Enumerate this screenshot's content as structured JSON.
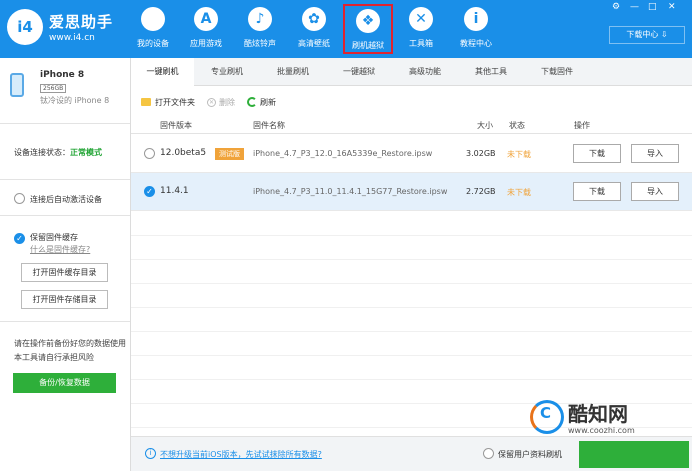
{
  "app": {
    "title": "爱思助手",
    "url": "www.i4.cn",
    "logo_text": "i4"
  },
  "nav": [
    {
      "label": "我的设备",
      "icon": "apple-icon",
      "glyph": ""
    },
    {
      "label": "应用游戏",
      "icon": "app-store-icon",
      "glyph": "A"
    },
    {
      "label": "酷炫铃声",
      "icon": "bell-icon",
      "glyph": "♪"
    },
    {
      "label": "高清壁纸",
      "icon": "wallpaper-icon",
      "glyph": "✿"
    },
    {
      "label": "刷机越狱",
      "icon": "dropbox-icon",
      "glyph": "❖"
    },
    {
      "label": "工具箱",
      "icon": "tools-icon",
      "glyph": "✕"
    },
    {
      "label": "教程中心",
      "icon": "info-icon",
      "glyph": "i"
    }
  ],
  "download_center": "下载中心",
  "device": {
    "name": "iPhone 8",
    "capacity": "256GB",
    "model": "钛冷设的 iPhone 8"
  },
  "sidebar": {
    "conn_label": "设备连接状态：",
    "conn_status": "正常模式",
    "auto_activate": "连接后自动激活设备",
    "keep_cache": "保留固件缓存",
    "what_is_cache": "什么是固件缓存?",
    "open_cache_dir": "打开固件缓存目录",
    "open_storage_dir": "打开固件存储目录",
    "warning": "请在操作前备份好您的数据使用本工具请自行承担风险",
    "backup_btn": "备份/恢复数据"
  },
  "tabs": [
    "一键刷机",
    "专业刷机",
    "批量刷机",
    "一键越狱",
    "高级功能",
    "其他工具",
    "下载固件"
  ],
  "toolbar": {
    "open_folder": "打开文件夹",
    "delete": "删除",
    "refresh": "刷新"
  },
  "table": {
    "headers": [
      "固件版本",
      "固件名称",
      "大小",
      "状态",
      "操作"
    ],
    "rows": [
      {
        "version": "12.0beta5",
        "badge": "测试版",
        "name": "iPhone_4.7_P3_12.0_16A5339e_Restore.ipsw",
        "size": "3.02GB",
        "status": "未下载",
        "btn1": "下载",
        "btn2": "导入",
        "selected": false
      },
      {
        "version": "11.4.1",
        "badge": "",
        "name": "iPhone_4.7_P3_11.0_11.4.1_15G77_Restore.ipsw",
        "size": "2.72GB",
        "status": "未下载",
        "btn1": "下载",
        "btn2": "导入",
        "selected": true
      }
    ]
  },
  "footer": {
    "link": "不想升级当前iOS版本，先试试抹除所有数据?",
    "keep_data": "保留用户资料刷机"
  },
  "watermark": {
    "text": "酷知网",
    "url": "www.coozhi.com"
  }
}
